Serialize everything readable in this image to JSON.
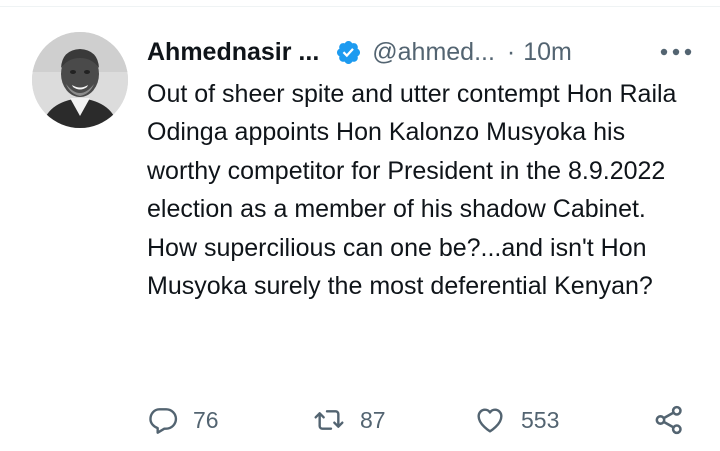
{
  "tweet": {
    "author_name": "Ahmednasir ...",
    "handle": "@ahmed...",
    "separator": "·",
    "time": "10m",
    "text": "Out of sheer spite and utter contempt Hon Raila Odinga appoints Hon Kalonzo Musyoka his worthy competitor for President in the 8.9.2022 election as a member of his shadow Cabinet. How supercilious can one be?...and isn't Hon Musyoka surely the most deferential Kenyan?",
    "stats": {
      "replies": "76",
      "retweets": "87",
      "likes": "553"
    }
  },
  "icons": {
    "verified": "verified-badge-icon",
    "more": "more-dots-icon",
    "reply": "reply-bubble-icon",
    "retweet": "retweet-arrows-icon",
    "like": "heart-icon",
    "share": "share-icon"
  },
  "colors": {
    "text": "#0f1419",
    "secondary": "#536471",
    "verified": "#1d9bf0",
    "background": "#ffffff"
  }
}
